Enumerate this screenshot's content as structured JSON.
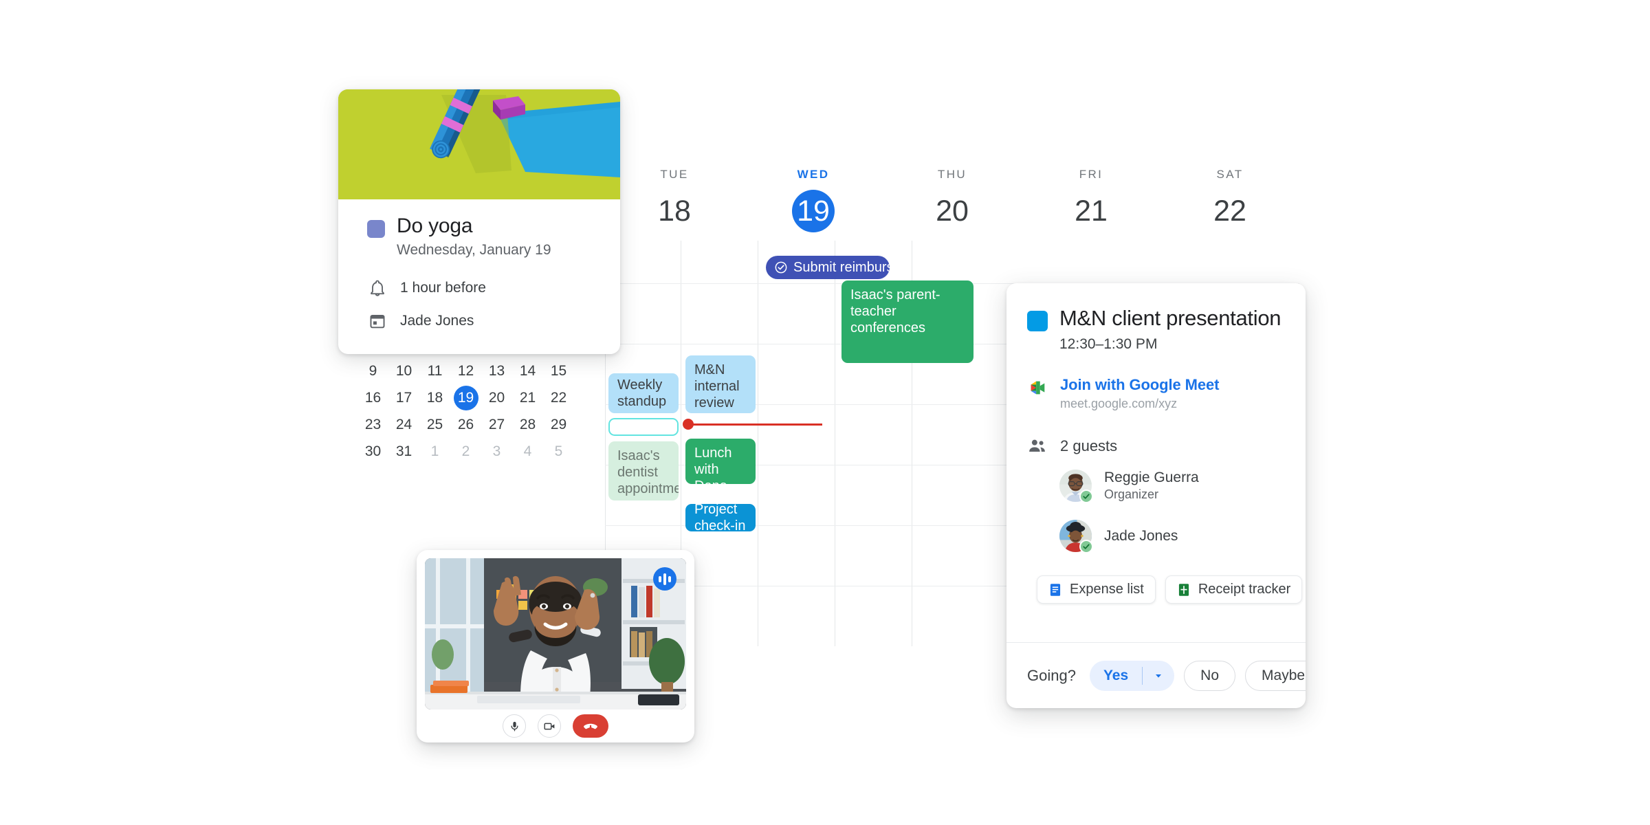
{
  "calendar": {
    "days": [
      {
        "dow": "TUE",
        "num": "18",
        "today": false
      },
      {
        "dow": "WED",
        "num": "19",
        "today": true
      },
      {
        "dow": "THU",
        "num": "20",
        "today": false
      },
      {
        "dow": "FRI",
        "num": "21",
        "today": false
      },
      {
        "dow": "SAT",
        "num": "22",
        "today": false
      }
    ],
    "events": [
      {
        "title": "Submit reimbursement",
        "kind": "task",
        "day": "WED"
      },
      {
        "title": "Isaac's parent-teacher conferences",
        "kind": "green",
        "day": "THU"
      },
      {
        "title": "Weekly standup",
        "kind": "lightblue",
        "day": "TUE"
      },
      {
        "title": "M&N internal review",
        "kind": "lightblue",
        "day": "WED"
      },
      {
        "title": "Isaac's dentist appointment",
        "kind": "greenlight",
        "day": "TUE"
      },
      {
        "title": "Lunch with Dana",
        "kind": "green",
        "day": "WED"
      },
      {
        "title": "Project check-in",
        "kind": "brightblue",
        "day": "WED"
      }
    ],
    "now_indicator_color": "#d93025"
  },
  "minical": {
    "weeks": [
      [
        {
          "d": "9"
        },
        {
          "d": "10"
        },
        {
          "d": "11"
        },
        {
          "d": "12"
        },
        {
          "d": "13"
        },
        {
          "d": "14"
        },
        {
          "d": "15"
        }
      ],
      [
        {
          "d": "16"
        },
        {
          "d": "17"
        },
        {
          "d": "18"
        },
        {
          "d": "19",
          "sel": true
        },
        {
          "d": "20"
        },
        {
          "d": "21"
        },
        {
          "d": "22"
        }
      ],
      [
        {
          "d": "23"
        },
        {
          "d": "24"
        },
        {
          "d": "25"
        },
        {
          "d": "26"
        },
        {
          "d": "27"
        },
        {
          "d": "28"
        },
        {
          "d": "29"
        }
      ],
      [
        {
          "d": "30"
        },
        {
          "d": "31"
        },
        {
          "d": "1",
          "muted": true
        },
        {
          "d": "2",
          "muted": true
        },
        {
          "d": "3",
          "muted": true
        },
        {
          "d": "4",
          "muted": true
        },
        {
          "d": "5",
          "muted": true
        }
      ]
    ]
  },
  "yoga_card": {
    "title": "Do yoga",
    "date": "Wednesday, January 19",
    "reminder": "1 hour before",
    "calendar_owner": "Jade Jones",
    "swatch_color": "#7986cb",
    "banner_color": "#c0d02f"
  },
  "detail_card": {
    "title": "M&N client presentation",
    "time": "12:30–1:30 PM",
    "swatch_color": "#039be5",
    "meet_link_label": "Join with Google Meet",
    "meet_url": "meet.google.com/xyz",
    "guests_count_label": "2 guests",
    "guests": [
      {
        "name": "Reggie Guerra",
        "role": "Organizer"
      },
      {
        "name": "Jade Jones",
        "role": ""
      }
    ],
    "attachments": [
      {
        "label": "Expense list",
        "app": "docs"
      },
      {
        "label": "Receipt tracker",
        "app": "sheets"
      }
    ],
    "rsvp": {
      "prompt": "Going?",
      "yes": "Yes",
      "no": "No",
      "maybe": "Maybe",
      "selected": "Yes"
    }
  },
  "meet_window": {
    "controls": [
      "mic",
      "camera",
      "hangup"
    ],
    "hangup_color": "#d93f33",
    "badge_color": "#1a73e8"
  }
}
